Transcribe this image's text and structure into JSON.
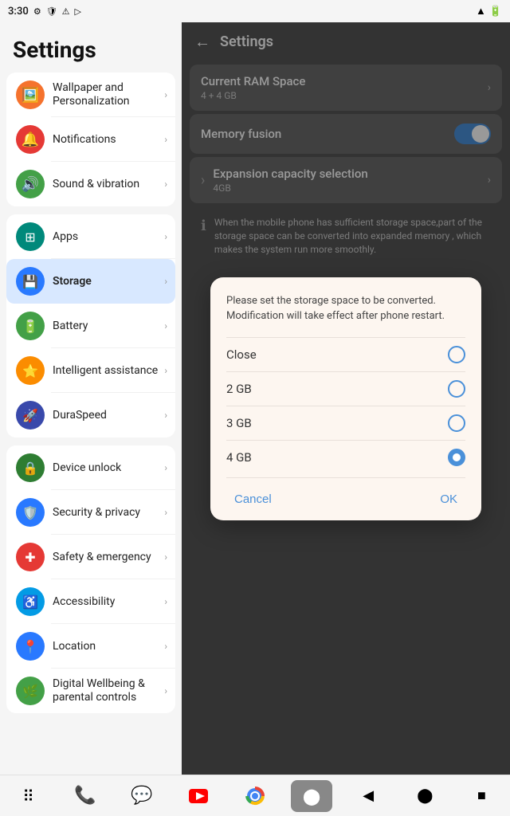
{
  "statusBar": {
    "time": "3:30",
    "leftIcons": [
      "gear",
      "shield",
      "alert",
      "play"
    ],
    "rightIcons": [
      "wifi",
      "battery"
    ]
  },
  "sidebar": {
    "title": "Settings",
    "groups": [
      {
        "items": [
          {
            "id": "wallpaper",
            "label": "Wallpaper and Personalization",
            "icon": "🖼️",
            "color": "bg-orange"
          },
          {
            "id": "notifications",
            "label": "Notifications",
            "icon": "🔔",
            "color": "bg-red"
          },
          {
            "id": "sound",
            "label": "Sound & vibration",
            "icon": "🔊",
            "color": "bg-green"
          }
        ]
      },
      {
        "items": [
          {
            "id": "apps",
            "label": "Apps",
            "icon": "⊞",
            "color": "bg-teal"
          },
          {
            "id": "storage",
            "label": "Storage",
            "icon": "💾",
            "color": "bg-blue",
            "active": true
          },
          {
            "id": "battery",
            "label": "Battery",
            "icon": "🔋",
            "color": "bg-green"
          },
          {
            "id": "intelligent",
            "label": "Intelligent assistance",
            "icon": "⭐",
            "color": "bg-amber"
          },
          {
            "id": "duraspeed",
            "label": "DuraSpeed",
            "icon": "🚀",
            "color": "bg-indigo"
          }
        ]
      },
      {
        "items": [
          {
            "id": "deviceunlock",
            "label": "Device unlock",
            "icon": "🔒",
            "color": "bg-deepgreen"
          },
          {
            "id": "security",
            "label": "Security & privacy",
            "icon": "🛡️",
            "color": "bg-blue"
          },
          {
            "id": "safety",
            "label": "Safety & emergency",
            "icon": "✚",
            "color": "bg-red"
          },
          {
            "id": "accessibility",
            "label": "Accessibility",
            "icon": "♿",
            "color": "bg-lightblue"
          },
          {
            "id": "location",
            "label": "Location",
            "icon": "📍",
            "color": "bg-blue"
          },
          {
            "id": "digitalwellbeing",
            "label": "Digital Wellbeing & parental controls",
            "icon": "🌿",
            "color": "bg-green"
          }
        ]
      }
    ]
  },
  "mainPanel": {
    "header": {
      "title": "Settings",
      "backLabel": "←"
    },
    "rows": [
      {
        "id": "currentram",
        "label": "Current RAM Space",
        "sub": "4 + 4 GB",
        "type": "chevron"
      },
      {
        "id": "memoryfusion",
        "label": "Memory fusion",
        "sub": "",
        "type": "toggle",
        "toggleOn": true
      },
      {
        "id": "expansion",
        "label": "Expansion capacity selection",
        "sub": "4GB",
        "type": "chevron"
      }
    ],
    "infoText": "When the mobile phone has sufficient storage space,part of the storage space can be converted into expanded memory , which makes the system run more smoothly."
  },
  "dialog": {
    "message": "Please set the storage space to be converted. Modification will take effect after phone restart.",
    "options": [
      {
        "label": "Close",
        "value": "close",
        "selected": false
      },
      {
        "label": "2 GB",
        "value": "2gb",
        "selected": false
      },
      {
        "label": "3 GB",
        "value": "3gb",
        "selected": false
      },
      {
        "label": "4 GB",
        "value": "4gb",
        "selected": true
      }
    ],
    "cancelLabel": "Cancel",
    "okLabel": "OK"
  },
  "bottomNav": [
    {
      "id": "grid",
      "icon": "⠿",
      "label": "grid"
    },
    {
      "id": "phone",
      "icon": "📞",
      "label": "phone"
    },
    {
      "id": "message",
      "icon": "💬",
      "label": "message"
    },
    {
      "id": "youtube",
      "icon": "▶",
      "label": "youtube"
    },
    {
      "id": "chrome",
      "icon": "◎",
      "label": "chrome"
    },
    {
      "id": "camera",
      "icon": "⬤",
      "label": "camera"
    },
    {
      "id": "back",
      "icon": "◀",
      "label": "back"
    },
    {
      "id": "home",
      "icon": "⬤",
      "label": "home"
    },
    {
      "id": "recents",
      "icon": "■",
      "label": "recents"
    }
  ]
}
